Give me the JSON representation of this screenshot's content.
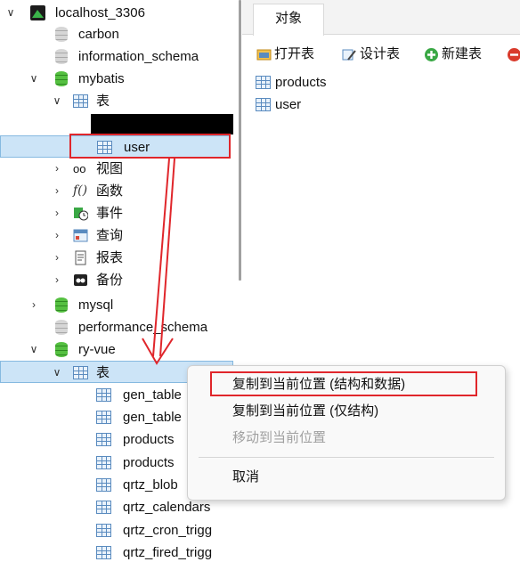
{
  "tree": {
    "connection": "localhost_3306",
    "db_carbon": "carbon",
    "db_information_schema": "information_schema",
    "db_mybatis": "mybatis",
    "mybatis_tables": "表",
    "table_user": "user",
    "views": "视图",
    "functions": "函数",
    "events": "事件",
    "queries": "查询",
    "reports": "报表",
    "backups": "备份",
    "db_mysql": "mysql",
    "db_performance_schema": "performance_schema",
    "db_ry_vue": "ry-vue",
    "ry_tables": "表",
    "ry_table_items": [
      "gen_table",
      "gen_table",
      "products",
      "products",
      "qrtz_blob",
      "qrtz_calendars",
      "qrtz_cron_trigg",
      "qrtz_fired_trigg"
    ]
  },
  "right_panel": {
    "tab_label": "对象",
    "toolbar": {
      "open_table": "打开表",
      "design_table": "设计表",
      "new_table": "新建表"
    },
    "objects": [
      "products",
      "user"
    ]
  },
  "context_menu": {
    "copy_structure_and_data": "复制到当前位置 (结构和数据)",
    "copy_structure_only": "复制到当前位置 (仅结构)",
    "move_here": "移动到当前位置",
    "cancel": "取消"
  },
  "colors": {
    "selection": "#cce4f7",
    "annotation_red": "#e0262b"
  }
}
